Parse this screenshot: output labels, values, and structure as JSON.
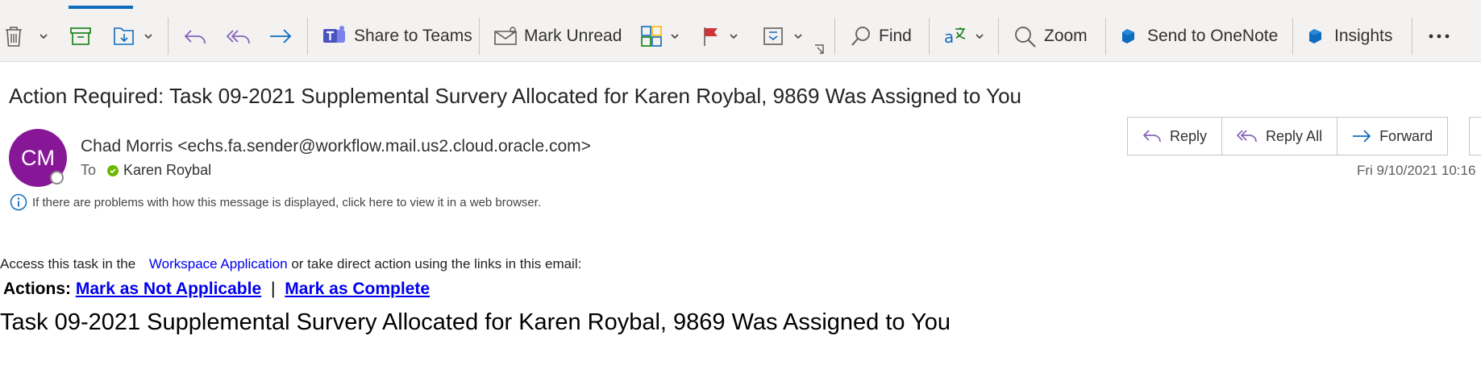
{
  "toolbar": {
    "share_label": "Share to Teams",
    "mark_unread_label": "Mark Unread",
    "find_label": "Find",
    "zoom_label": "Zoom",
    "onenote_label": "Send to OneNote",
    "insights_label": "Insights",
    "more_label": "···",
    "accent_color": "#0f6cbd"
  },
  "message": {
    "subject": "Action Required: Task 09-2021 Supplemental Survery Allocated for Karen Roybal, 9869 Was Assigned to You",
    "avatar_initials": "CM",
    "avatar_color": "#881798",
    "sender": "Chad Morris <echs.fa.sender@workflow.mail.us2.cloud.oracle.com>",
    "to_label": "To",
    "recipient": "Karen Roybal",
    "date": "Fri 9/10/2021 10:16",
    "info_text": "If there are problems with how this message is displayed, click here to view it in a web browser."
  },
  "reply_actions": {
    "reply": "Reply",
    "reply_all": "Reply All",
    "forward": "Forward"
  },
  "body": {
    "intro_prefix": "Access this task in the",
    "workspace_link": "Workspace Application",
    "intro_suffix": "or take direct action using the links in this email:",
    "actions_label": "Actions:",
    "not_applicable_link": "Mark as Not Applicable",
    "separator": "|",
    "complete_link": "Mark as Complete",
    "task_title": "Task 09-2021 Supplemental Survery Allocated for Karen Roybal, 9869 Was Assigned to You"
  }
}
